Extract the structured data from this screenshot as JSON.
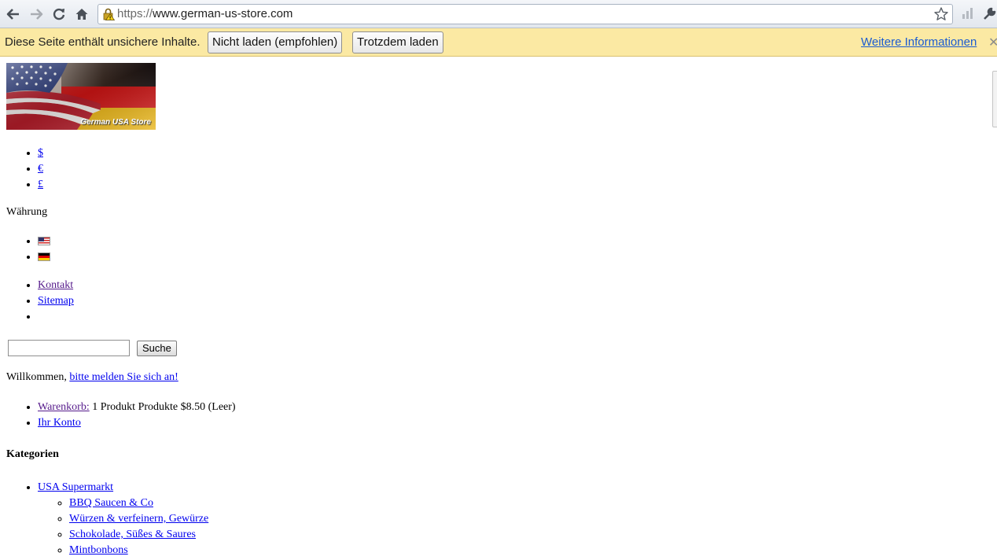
{
  "browser": {
    "url_scheme": "https://",
    "url_host": "www.german-us-store.com"
  },
  "infobar": {
    "message": "Diese Seite enthält unsichere Inhalte.",
    "dont_load": "Nicht laden (empfohlen)",
    "load_anyway": "Trotzdem laden",
    "more_info": "Weitere Informationen"
  },
  "logo": {
    "text": "German USA Store"
  },
  "currency": {
    "items": [
      "$",
      "€",
      "£"
    ],
    "label": "Währung"
  },
  "language_flags": [
    "us-flag-icon",
    "de-flag-icon"
  ],
  "links": {
    "contact": "Kontakt",
    "sitemap": "Sitemap"
  },
  "search": {
    "value": "",
    "button": "Suche"
  },
  "welcome": {
    "prefix": "Willkommen,",
    "login_link": "bitte melden Sie sich an!"
  },
  "cart": {
    "link": "Warenkorb:",
    "summary": "1 Produkt Produkte $8.50 (Leer)",
    "account": "Ihr Konto"
  },
  "categories": {
    "heading": "Kategorien",
    "top": "USA Supermarkt",
    "sub": [
      "BBQ Saucen & Co",
      "Würzen & verfeinern, Gewürze",
      "Schokolade, Süßes & Saures",
      "Mintbonbons"
    ]
  },
  "colors": {
    "infobar_bg": "#fbe9a3",
    "link": "#0000ee",
    "visited_link": "#551a8b"
  }
}
